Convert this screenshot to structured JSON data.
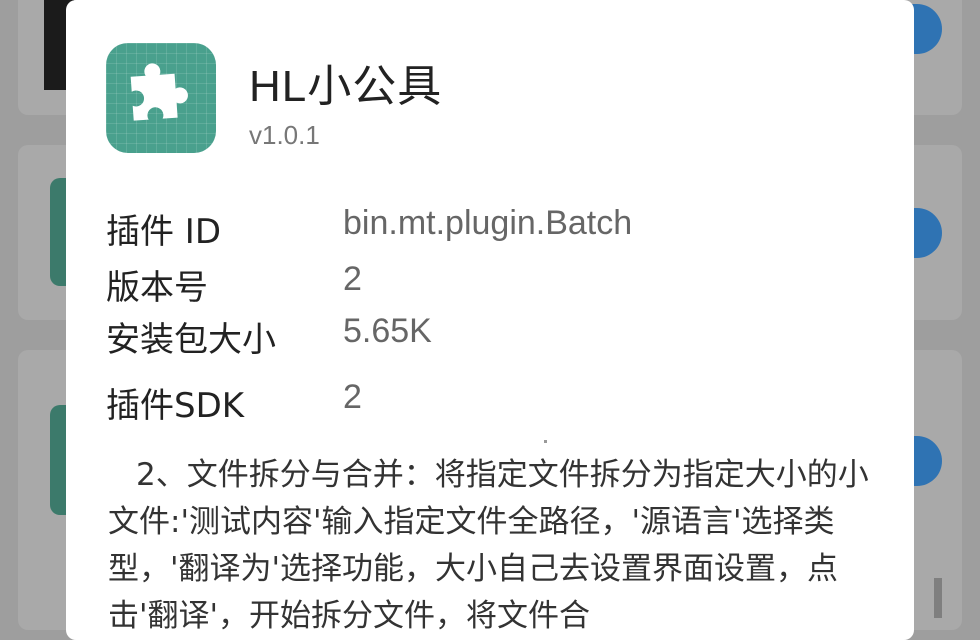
{
  "dialog": {
    "app_name": "HL小公具",
    "version": "v1.0.1",
    "icon": "puzzle-piece-icon",
    "icon_bg": "#49a08d",
    "rows": [
      {
        "label": "插件 ID",
        "value": "bin.mt.plugin.Batch"
      },
      {
        "label": "版本号",
        "value": "2"
      },
      {
        "label": "安装包大小",
        "value": "5.65K"
      },
      {
        "label": "插件SDK",
        "value": "2"
      }
    ],
    "description": "2、文件拆分与合并：将指定文件拆分为指定大小的小文件:'测试内容'输入指定文件全路径，'源语言'选择类型，'翻译为'选择功能，大小自己去设置界面设置，点击'翻译'，开始拆分文件，将文件合"
  }
}
